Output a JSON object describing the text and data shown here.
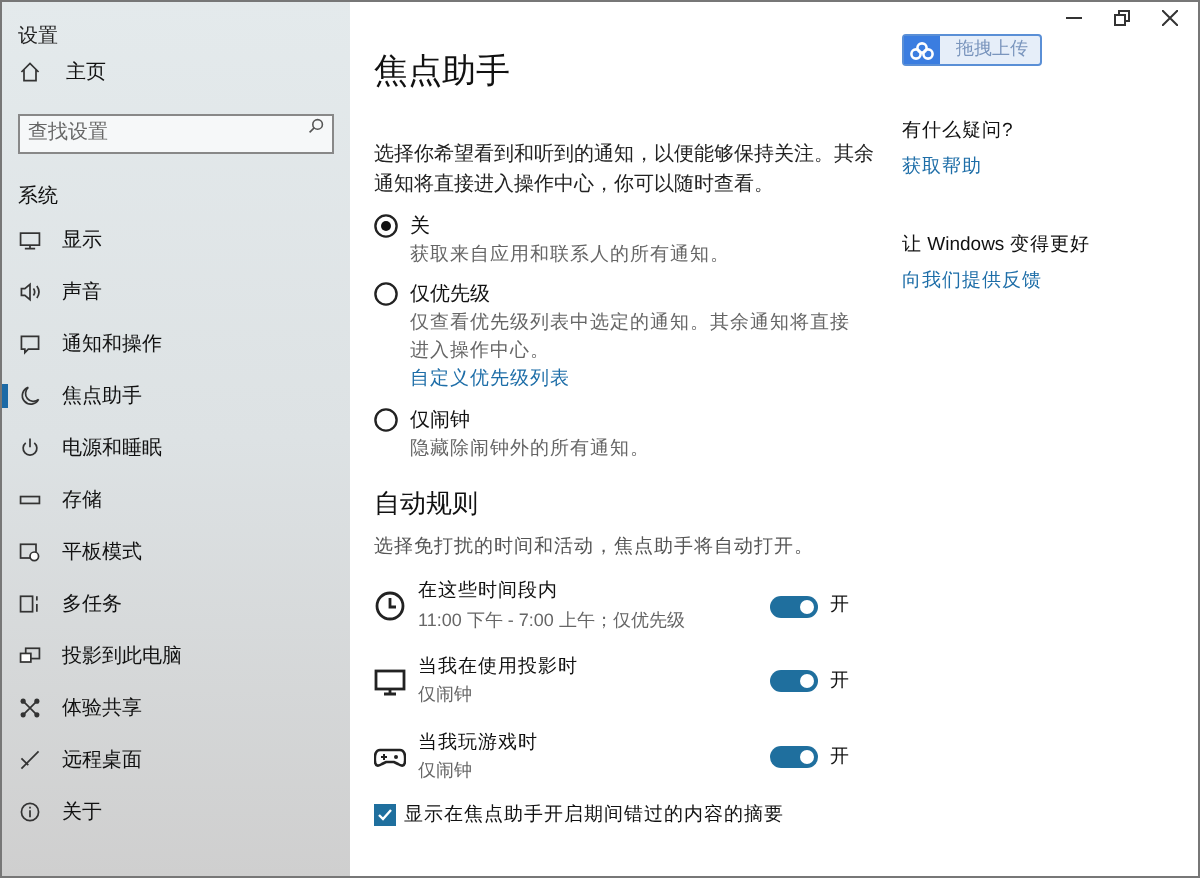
{
  "window": {
    "title": "设置"
  },
  "upload_button": {
    "label": "拖拽上传"
  },
  "sidebar": {
    "home": "主页",
    "search": {
      "placeholder": "查找设置"
    },
    "section": "系统",
    "items": [
      {
        "label": "显示",
        "kind": "display",
        "selected": false
      },
      {
        "label": "声音",
        "kind": "sound",
        "selected": false
      },
      {
        "label": "通知和操作",
        "kind": "notify",
        "selected": false
      },
      {
        "label": "焦点助手",
        "kind": "moon",
        "selected": true
      },
      {
        "label": "电源和睡眠",
        "kind": "power",
        "selected": false
      },
      {
        "label": "存储",
        "kind": "storage",
        "selected": false
      },
      {
        "label": "平板模式",
        "kind": "tablet",
        "selected": false
      },
      {
        "label": "多任务",
        "kind": "multitask",
        "selected": false
      },
      {
        "label": "投影到此电脑",
        "kind": "project",
        "selected": false
      },
      {
        "label": "体验共享",
        "kind": "share",
        "selected": false
      },
      {
        "label": "远程桌面",
        "kind": "remote",
        "selected": false
      },
      {
        "label": "关于",
        "kind": "info",
        "selected": false
      }
    ]
  },
  "main": {
    "title": "焦点助手",
    "description": "选择你希望看到和听到的通知，以便能够保持关注。其余通知将直接进入操作中心，你可以随时查看。",
    "options": [
      {
        "label": "关",
        "description": "获取来自应用和联系人的所有通知。",
        "selected": true
      },
      {
        "label": "仅优先级",
        "description": "仅查看优先级列表中选定的通知。其余通知将直接进入操作中心。",
        "link": "自定义优先级列表",
        "selected": false
      },
      {
        "label": "仅闹钟",
        "description": "隐藏除闹钟外的所有通知。",
        "selected": false
      }
    ],
    "auto_rules": {
      "heading": "自动规则",
      "description": "选择免打扰的时间和活动，焦点助手将自动打开。",
      "rules": [
        {
          "kind": "clock",
          "label": "在这些时间段内",
          "detail": "11:00 下午 - 7:00 上午；仅优先级",
          "on": true,
          "state_label": "开"
        },
        {
          "kind": "monitor",
          "label": "当我在使用投影时",
          "detail": "仅闹钟",
          "on": true,
          "state_label": "开"
        },
        {
          "kind": "gamepad",
          "label": "当我玩游戏时",
          "detail": "仅闹钟",
          "on": true,
          "state_label": "开"
        }
      ]
    },
    "summary_checkbox": {
      "label": "显示在焦点助手开启期间错过的内容的摘要",
      "checked": true
    }
  },
  "right": {
    "help_heading": "有什么疑问?",
    "help_link": "获取帮助",
    "feedback_heading": "让 Windows 变得更好",
    "feedback_link": "向我们提供反馈"
  }
}
